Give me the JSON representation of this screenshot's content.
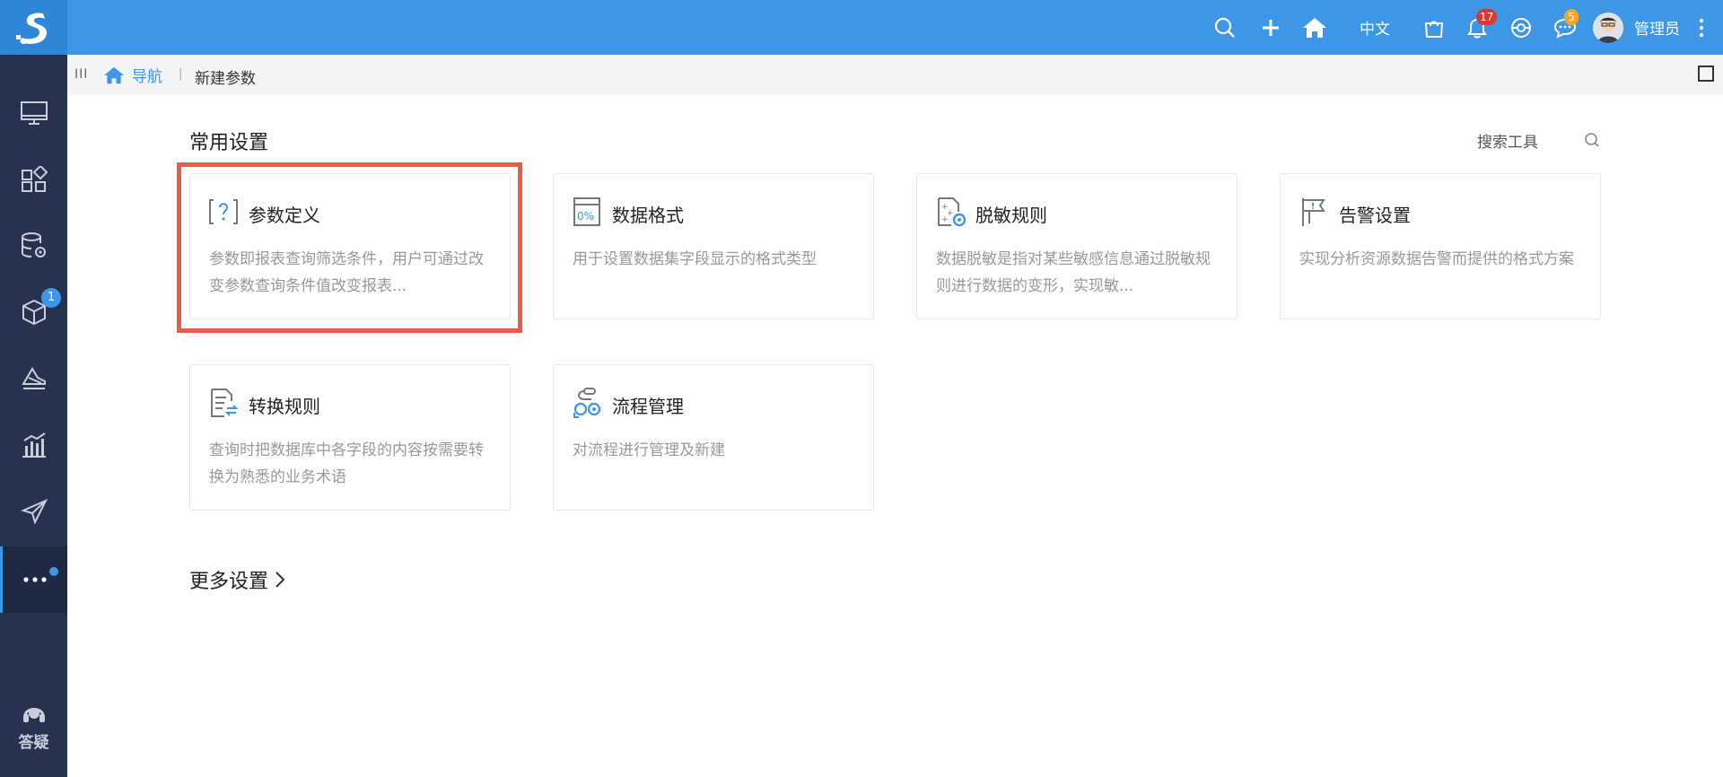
{
  "header": {
    "language": "中文",
    "notifications_count": "17",
    "messages_count": "5",
    "user_name": "管理员"
  },
  "sidebar": {
    "items": [
      {
        "icon": "monitor-icon"
      },
      {
        "icon": "apps-grid-icon"
      },
      {
        "icon": "database-settings-icon"
      },
      {
        "icon": "cube-icon",
        "badge": "1"
      },
      {
        "icon": "layers-icon"
      },
      {
        "icon": "bar-chart-icon"
      },
      {
        "icon": "send-icon"
      },
      {
        "icon": "more-dots-icon",
        "active": true
      }
    ],
    "help_label": "答疑"
  },
  "breadcrumb": {
    "home_label": "导航",
    "current": "新建参数"
  },
  "main": {
    "section_title": "常用设置",
    "search_tool_label": "搜索工具",
    "cards": [
      {
        "title": "参数定义",
        "desc": "参数即报表查询筛选条件，用户可通过改变参数查询条件值改变报表...",
        "icon": "parameter-icon"
      },
      {
        "title": "数据格式",
        "desc": "用于设置数据集字段显示的格式类型",
        "icon": "data-format-icon"
      },
      {
        "title": "脱敏规则",
        "desc": "数据脱敏是指对某些敏感信息通过脱敏规则进行数据的变形，实现敏...",
        "icon": "desensitize-icon"
      },
      {
        "title": "告警设置",
        "desc": "实现分析资源数据告警而提供的格式方案",
        "icon": "alarm-flag-icon"
      },
      {
        "title": "转换规则",
        "desc": "查询时把数据库中各字段的内容按需要转换为熟悉的业务术语",
        "icon": "convert-rule-icon"
      },
      {
        "title": "流程管理",
        "desc": "对流程进行管理及新建",
        "icon": "workflow-icon"
      }
    ],
    "more_label": "更多设置"
  },
  "colors": {
    "topbar": "#3d96e6",
    "sidebar": "#26324e",
    "highlight": "#ee5a4a",
    "accent": "#3d96e6"
  }
}
